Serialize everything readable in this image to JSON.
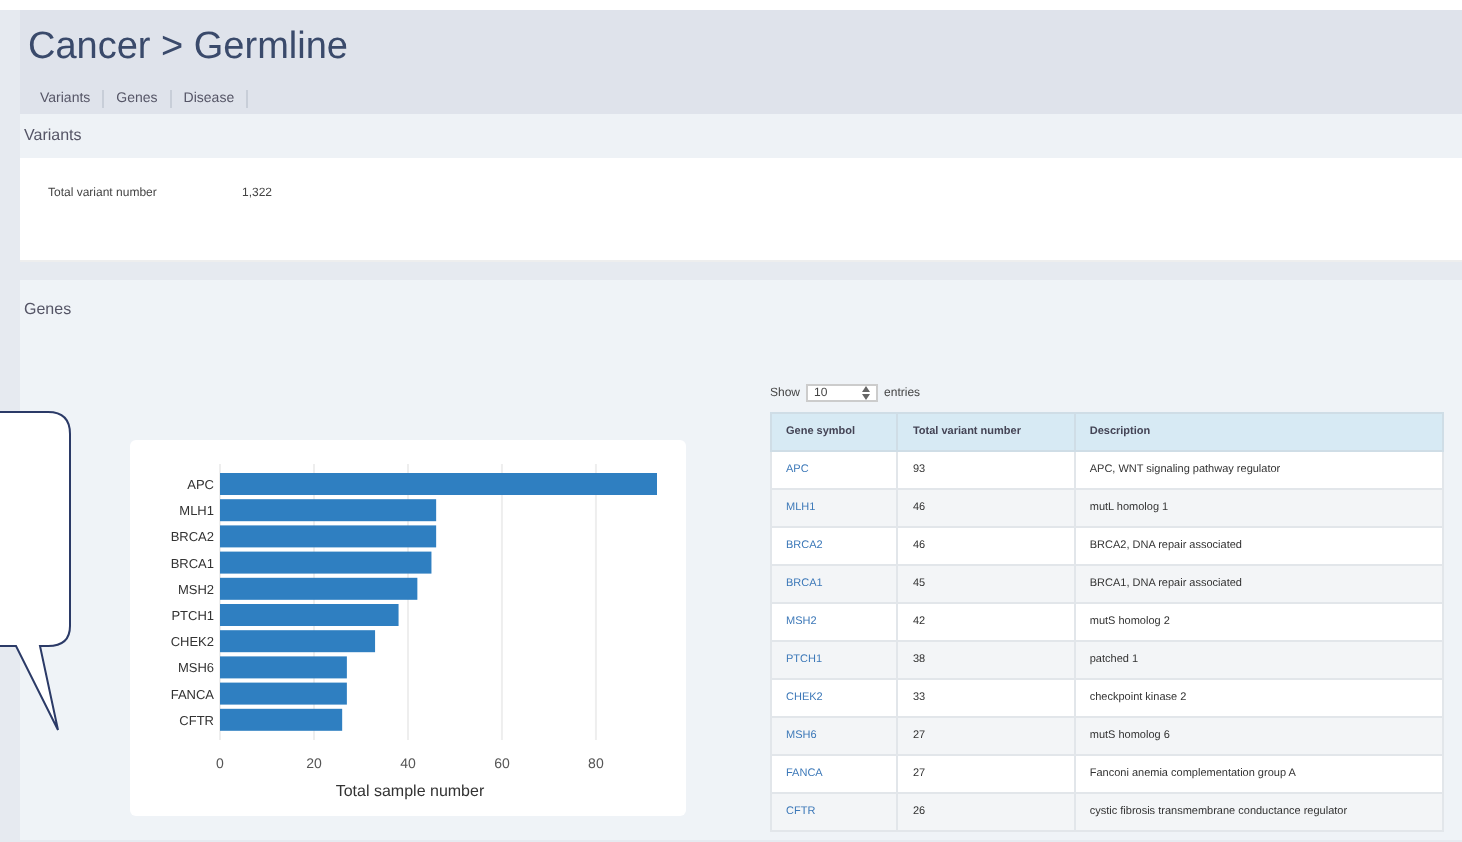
{
  "header": {
    "title": "Cancer > Germline"
  },
  "tabs": [
    {
      "label": "Variants",
      "selected": false
    },
    {
      "label": "Genes",
      "selected": false
    },
    {
      "label": "Disease",
      "selected": false
    }
  ],
  "variants": {
    "title": "Variants",
    "label": "Total variant number",
    "value": "1,322"
  },
  "genes": {
    "title": "Genes",
    "chart_data": {
      "type": "bar",
      "orientation": "horizontal",
      "xlabel": "Total sample number",
      "categories": [
        "APC",
        "MLH1",
        "BRCA2",
        "BRCA1",
        "MSH2",
        "PTCH1",
        "CHEK2",
        "MSH6",
        "FANCA",
        "CFTR"
      ],
      "values": [
        93,
        46,
        46,
        45,
        42,
        38,
        33,
        27,
        27,
        26
      ],
      "xlim": [
        0,
        93
      ],
      "xticks": [
        0,
        20,
        40,
        60,
        80
      ],
      "grid": true
    },
    "length": {
      "before": "Show",
      "value": "10",
      "after": "entries"
    },
    "table": {
      "columns": [
        "Gene symbol",
        "Total variant number",
        "Description"
      ],
      "rows": [
        [
          "APC",
          "93",
          "APC, WNT signaling pathway regulator"
        ],
        [
          "MLH1",
          "46",
          "mutL homolog 1"
        ],
        [
          "BRCA2",
          "46",
          "BRCA2, DNA repair associated"
        ],
        [
          "BRCA1",
          "45",
          "BRCA1, DNA repair associated"
        ],
        [
          "MSH2",
          "42",
          "mutS homolog 2"
        ],
        [
          "PTCH1",
          "38",
          "patched 1"
        ],
        [
          "CHEK2",
          "33",
          "checkpoint kinase 2"
        ],
        [
          "MSH6",
          "27",
          "mutS homolog 6"
        ],
        [
          "FANCA",
          "27",
          "Fanconi anemia complementation group A"
        ],
        [
          "CFTR",
          "26",
          "cystic fibrosis transmembrane conductance regulator"
        ]
      ]
    }
  }
}
